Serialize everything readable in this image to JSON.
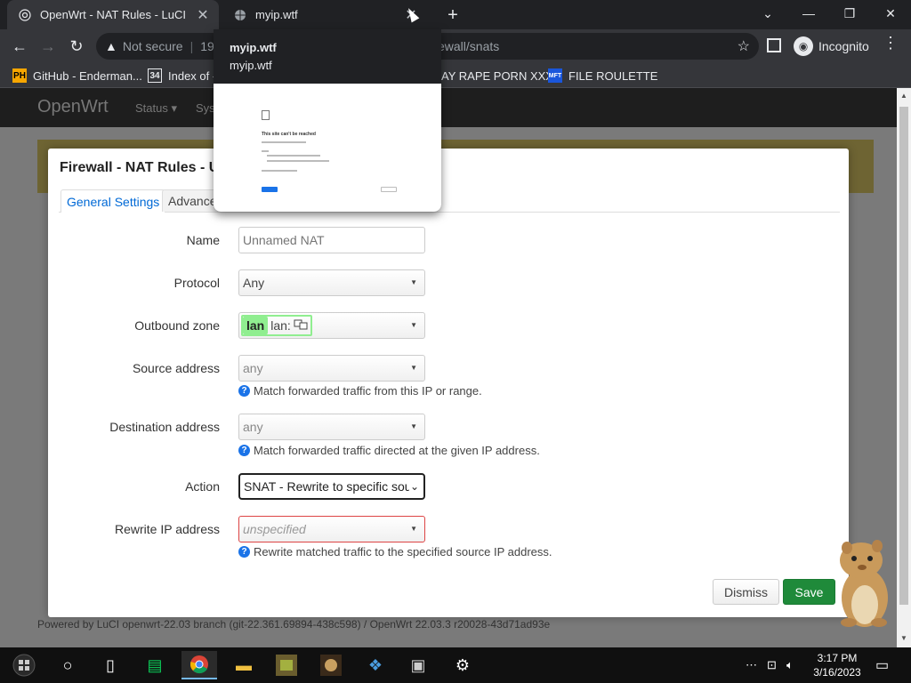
{
  "browser": {
    "tabs": [
      {
        "title": "OpenWrt - NAT Rules - LuCI",
        "active": true
      },
      {
        "title": "myip.wtf",
        "active": false
      }
    ],
    "toolbar": {
      "security_label": "Not secure",
      "url_start": "19",
      "url_tail": "ewall/snats",
      "incognito_label": "Incognito"
    },
    "bookmarks": [
      {
        "icon": "PH",
        "label": "GitHub - Enderman..."
      },
      {
        "icon": "34",
        "label": "Index of -"
      },
      {
        "icon": "",
        "label": "AY RAPE PORN XXX"
      },
      {
        "icon": "MFT",
        "label": "FILE ROULETTE"
      }
    ],
    "hover_card": {
      "title": "myip.wtf",
      "domain": "myip.wtf",
      "preview_title": "This site can't be reached"
    }
  },
  "background_page": {
    "brand": "OpenWrt",
    "menu": [
      "Status ▾",
      "Sys"
    ],
    "footer": "Powered by LuCI openwrt-22.03 branch (git-22.361.69894-438c598) / OpenWrt 22.03.3 r20028-43d71ad93e"
  },
  "modal": {
    "title": "Firewall - NAT Rules - U",
    "tabs": [
      "General Settings",
      "Advance"
    ],
    "fields": {
      "name": {
        "label": "Name",
        "placeholder": "Unnamed NAT"
      },
      "protocol": {
        "label": "Protocol",
        "value": "Any"
      },
      "outbound_zone": {
        "label": "Outbound zone",
        "chip": "lan",
        "value": "lan:"
      },
      "source_address": {
        "label": "Source address",
        "value": "any",
        "hint": "Match forwarded traffic from this IP or range."
      },
      "destination_address": {
        "label": "Destination address",
        "value": "any",
        "hint": "Match forwarded traffic directed at the given IP address."
      },
      "action": {
        "label": "Action",
        "value": "SNAT - Rewrite to specific sour"
      },
      "rewrite_ip": {
        "label": "Rewrite IP address",
        "value": "unspecified",
        "hint": "Rewrite matched traffic to the specified source IP address."
      }
    },
    "buttons": {
      "dismiss": "Dismiss",
      "save": "Save"
    }
  },
  "taskbar": {
    "time": "3:17 PM",
    "date": "3/16/2023"
  },
  "colors": {
    "save_green": "#1f8a3a",
    "zone_green": "#90ee90",
    "tab_link": "#0069d6",
    "error_red": "#d44444"
  }
}
